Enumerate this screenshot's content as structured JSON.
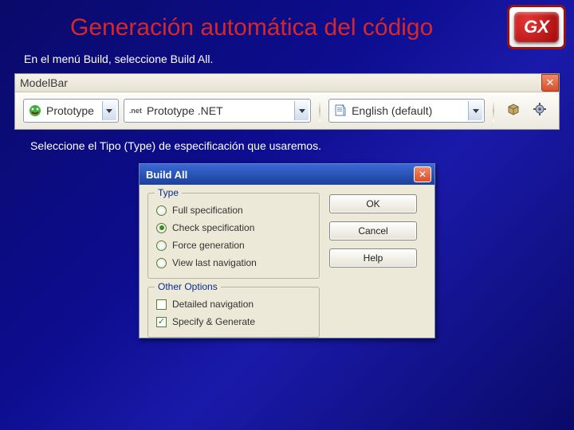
{
  "title": "Generación automática del código",
  "caption1": "En el menú Build, seleccione Build All.",
  "caption2": "Seleccione el Tipo (Type) de especificación que usaremos.",
  "gx_logo_text": "GX",
  "modelbar": {
    "title": "ModelBar",
    "close_glyph": "✕",
    "combo_prototype": "Prototype",
    "combo_platform_prefix": ".net",
    "combo_platform_label": "Prototype .NET",
    "combo_language": "English (default)"
  },
  "dialog": {
    "title": "Build All",
    "close_glyph": "✕",
    "group_type": "Type",
    "group_other": "Other Options",
    "radios": {
      "full": "Full specification",
      "check": "Check specification",
      "force": "Force generation",
      "viewlast": "View last navigation"
    },
    "checks": {
      "detailed": "Detailed navigation",
      "specify": "Specify & Generate"
    },
    "buttons": {
      "ok": "OK",
      "cancel": "Cancel",
      "help": "Help"
    }
  }
}
